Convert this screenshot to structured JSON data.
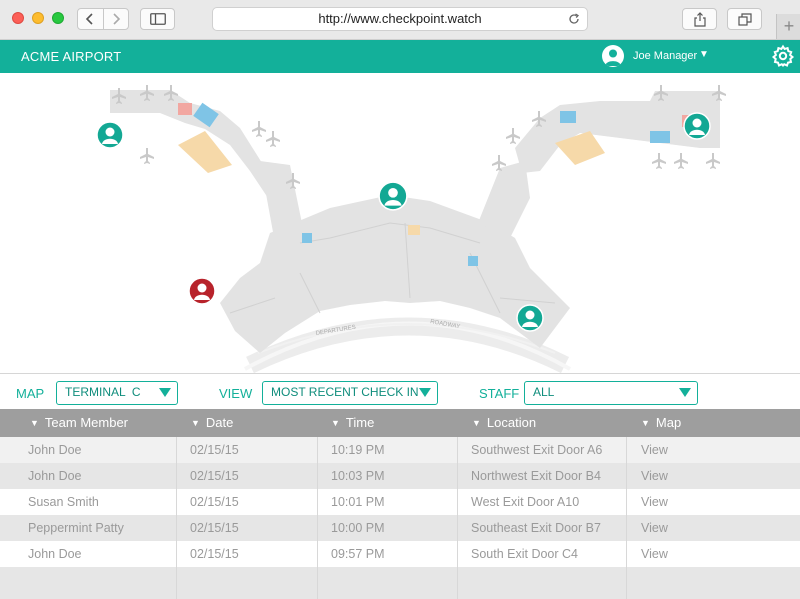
{
  "browser": {
    "url": "http://www.checkpoint.watch",
    "new_tab_symbol": "+"
  },
  "app": {
    "title": "ACME AIRPORT",
    "user_name": "Joe Manager",
    "user_caret": "▼"
  },
  "map": {
    "staff_markers": [
      {
        "status": "ok"
      },
      {
        "status": "ok"
      },
      {
        "status": "ok"
      },
      {
        "status": "ok"
      },
      {
        "status": "alert"
      }
    ],
    "road_labels": [
      "DEPARTURES",
      "ROADWAY"
    ],
    "colors": {
      "ok": "#13a894",
      "alert": "#b8232b",
      "building": "#e2e2e2"
    }
  },
  "filters": {
    "map_label": "MAP",
    "map_value": "TERMINAL  C",
    "view_label": "VIEW",
    "view_value": "MOST RECENT CHECK IN",
    "staff_label": "STAFF",
    "staff_value": "ALL"
  },
  "table": {
    "columns": [
      "Team Member",
      "Date",
      "Time",
      "Location",
      "Map"
    ],
    "sort_symbol": "▼",
    "rows": [
      {
        "member": "John Doe",
        "date": "02/15/15",
        "time": "10:19 PM",
        "location": "Southwest Exit Door A6",
        "map": "View"
      },
      {
        "member": "John Doe",
        "date": "02/15/15",
        "time": "10:03 PM",
        "location": "Northwest Exit Door B4",
        "map": "View"
      },
      {
        "member": "Susan Smith",
        "date": "02/15/15",
        "time": "10:01 PM",
        "location": "West Exit Door A10",
        "map": "View"
      },
      {
        "member": "Peppermint Patty",
        "date": "02/15/15",
        "time": "10:00 PM",
        "location": "Southeast Exit Door B7",
        "map": "View"
      },
      {
        "member": "John Doe",
        "date": "02/15/15",
        "time": "09:57 PM",
        "location": "South Exit Door C4",
        "map": "View"
      }
    ]
  },
  "colors": {
    "accent": "#13b09a",
    "header_gray": "#9e9e9e"
  }
}
